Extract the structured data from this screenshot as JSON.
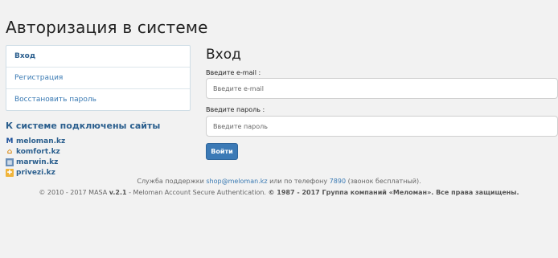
{
  "page_title": "Авторизация в системе",
  "sidebar": {
    "items": [
      {
        "label": "Вход"
      },
      {
        "label": "Регистрация"
      },
      {
        "label": "Восстановить пароль"
      }
    ]
  },
  "sites": {
    "title": "К системе подключены сайты",
    "items": [
      {
        "label": "meloman.kz",
        "icon": "meloman-logo-icon"
      },
      {
        "label": "komfort.kz",
        "icon": "komfort-logo-icon"
      },
      {
        "label": "marwin.kz",
        "icon": "marwin-logo-icon"
      },
      {
        "label": "privezi.kz",
        "icon": "privezi-logo-icon"
      }
    ]
  },
  "login": {
    "title": "Вход",
    "email_label": "Введите e-mail :",
    "email_placeholder": "Введите e-mail",
    "password_label": "Введите пароль :",
    "password_placeholder": "Введите пароль",
    "submit_label": "Войти"
  },
  "footer": {
    "support_prefix": "Служба поддержки ",
    "support_email": "shop@meloman.kz",
    "support_mid": " или по телефону ",
    "support_phone": "7890",
    "support_suffix": " (звонок бесплатный).",
    "copyright_plain": "© 2010 - 2017 MASA ",
    "version": "v.2.1",
    "copyright_mid": " - Meloman Account Secure Authentication. ",
    "copyright_bold": "© 1987 - 2017 Группа компаний «Меломан». Все права защищены."
  },
  "colors": {
    "accent": "#3c7ab6",
    "link": "#3a7ab3",
    "background": "#f2f2f2"
  }
}
